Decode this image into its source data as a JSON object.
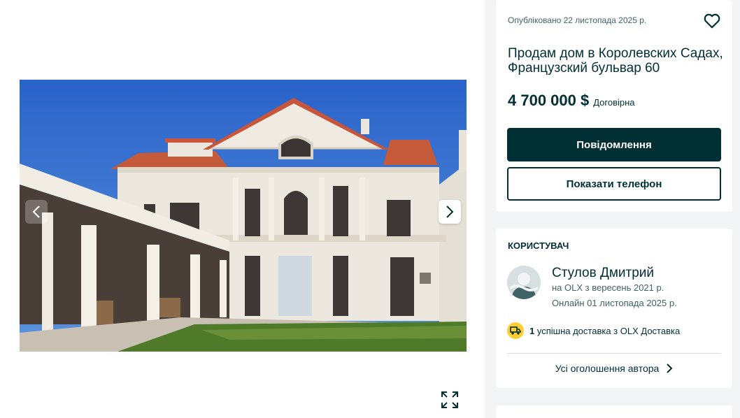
{
  "gallery": {
    "photo_alt": "",
    "icons": {
      "prev": "chevron-left-icon",
      "next": "chevron-right-icon",
      "fullscreen": "expand-icon"
    }
  },
  "ad": {
    "published": "Опубліковано 22 листопада 2025 р.",
    "title": "Продам дом в Королевских Садах, Французский бульвар 60",
    "price": "4 700 000 $",
    "negotiable": "Договірна",
    "message_button": "Повідомлення",
    "phone_button": "Показати телефон",
    "favorite_icon": "heart-icon"
  },
  "user": {
    "section_title": "КОРИСТУВАЧ",
    "name": "Стулов Дмитрий",
    "since": "на OLX з вересень 2021 р.",
    "online": "Онлайн 01 листопада 2025 р.",
    "delivery_count": "1",
    "delivery_text": "успішна доставка з OLX Доставка",
    "all_ads_link": "Усі оголошення автора"
  },
  "colors": {
    "primary": "#002f34",
    "background": "#f2f4f5",
    "delivery_badge": "#ffce32"
  }
}
